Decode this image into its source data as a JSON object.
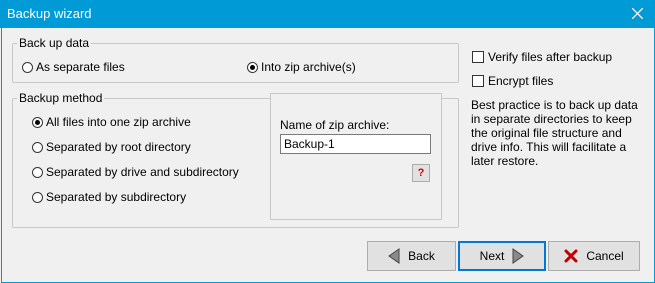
{
  "window": {
    "title": "Backup wizard"
  },
  "backup_data": {
    "legend": "Back up data",
    "options": [
      {
        "label": "As separate files",
        "checked": false
      },
      {
        "label": "Into zip archive(s)",
        "checked": true
      }
    ]
  },
  "backup_method": {
    "legend": "Backup method",
    "options": [
      {
        "label": "All files into one zip archive",
        "checked": true
      },
      {
        "label": "Separated by root directory",
        "checked": false
      },
      {
        "label": "Separated by drive and subdirectory",
        "checked": false
      },
      {
        "label": "Separated by subdirectory",
        "checked": false
      }
    ]
  },
  "archive": {
    "label": "Name of zip archive:",
    "value": "Backup-1",
    "help_label": "?"
  },
  "options": {
    "verify_label": "Verify files after backup",
    "encrypt_label": "Encrypt files"
  },
  "note": "Best practice is to back up data in separate directories to keep the original file structure and drive info. This will facilitate a later restore.",
  "buttons": {
    "back": "Back",
    "next": "Next",
    "cancel": "Cancel"
  },
  "colors": {
    "titlebar": "#009ad7",
    "default_border": "#0078d7",
    "cancel_icon": "#c00000",
    "help_icon": "#d40000"
  }
}
